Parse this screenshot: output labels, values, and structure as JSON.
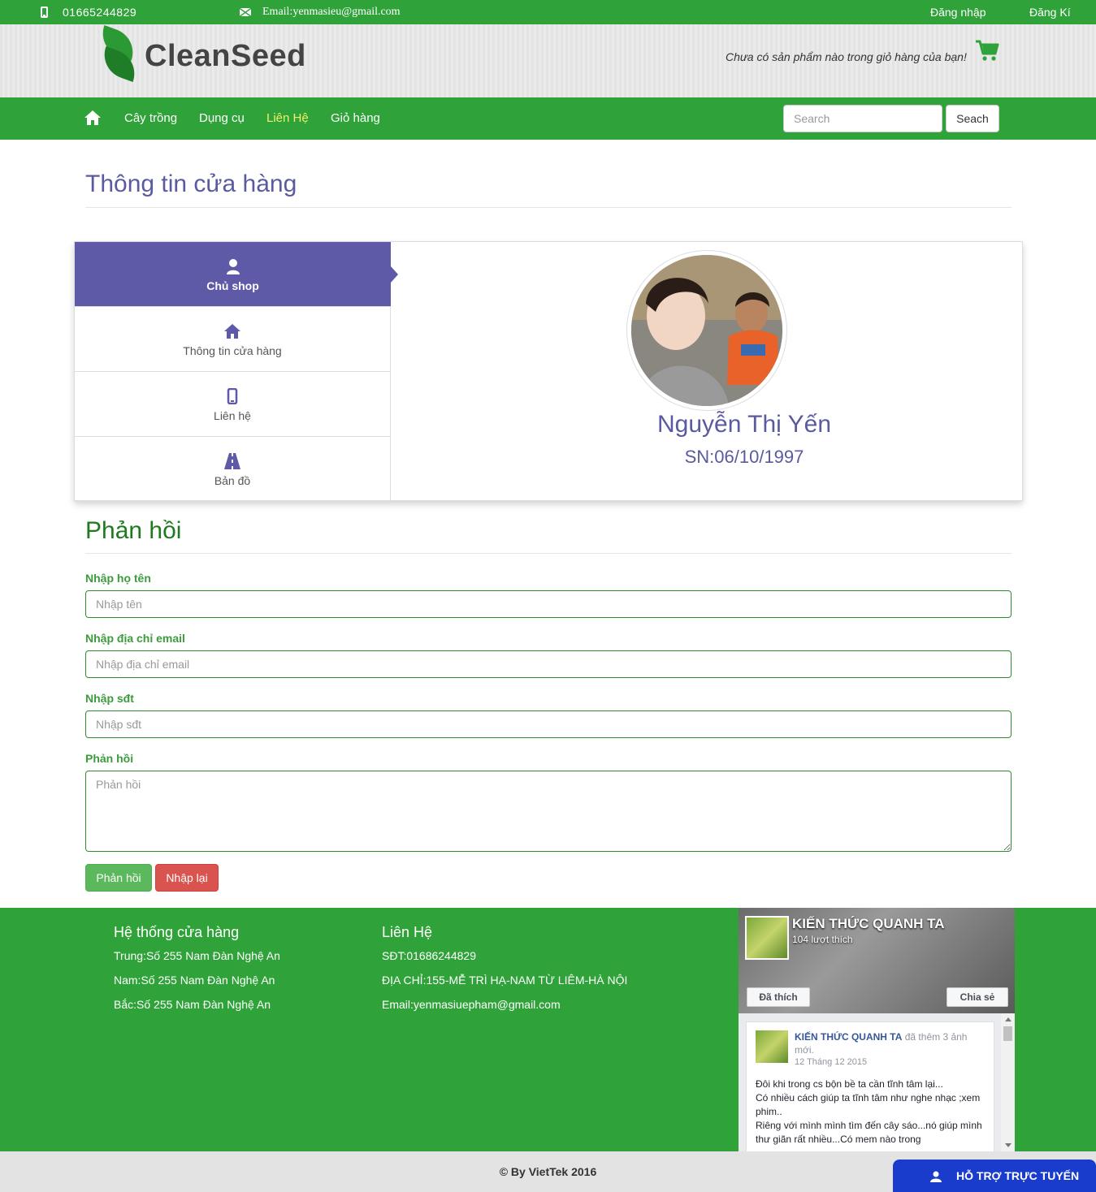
{
  "topbar": {
    "phone": "01665244829",
    "email": "Email:yenmasieu@gmail.com",
    "login": "Đăng nhập",
    "register": "Đăng Kí"
  },
  "header": {
    "logo_text": "CleanSeed",
    "cart_message": "Chưa có sản phẩm nào trong giỏ hàng của bạn!"
  },
  "nav": {
    "items": [
      "Cây trồng",
      "Dụng cụ",
      "Liên Hệ",
      "Giỏ hàng"
    ],
    "active": "Liên Hệ",
    "search_placeholder": "Search",
    "search_button": "Seach"
  },
  "store": {
    "title": "Thông tin cửa hàng",
    "tabs": [
      {
        "label": "Chủ shop",
        "icon": "user-icon"
      },
      {
        "label": "Thông tin cửa hàng",
        "icon": "home-icon"
      },
      {
        "label": "Liên hệ",
        "icon": "mobile-icon"
      },
      {
        "label": "Bản đồ",
        "icon": "road-icon"
      }
    ],
    "owner_name": "Nguyễn Thị Yến",
    "owner_dob": "SN:06/10/1997"
  },
  "feedback": {
    "title": "Phản hồi",
    "name_label": "Nhập họ tên",
    "name_placeholder": "Nhập tên",
    "email_label": "Nhập địa chỉ email",
    "email_placeholder": "Nhập địa chỉ email",
    "phone_label": "Nhập sđt",
    "phone_placeholder": "Nhập sđt",
    "message_label": "Phản hồi",
    "message_placeholder": "Phản hồi",
    "submit": "Phản hồi",
    "reset": "Nhập lại"
  },
  "footer": {
    "stores_title": "Hệ thống cửa hàng",
    "stores": [
      "Trung:Số 255 Nam Đàn Nghệ An",
      "Nam:Số 255 Nam Đàn Nghệ An",
      "Bắc:Số 255 Nam Đàn Nghệ An"
    ],
    "contact_title": "Liên Hệ",
    "contact": [
      "SĐT:01686244829",
      "ĐỊA CHỈ:155-MỄ TRÌ HẠ-NAM TỪ LIÊM-HÀ NỘI",
      "Email:yenmasiuepham@gmail.com"
    ],
    "fb": {
      "page_name": "KIẾN THỨC QUANH TA",
      "likes": "104 lượt thích",
      "liked_button": "Đã thích",
      "share_button": "Chia sẻ",
      "post_author": "KIẾN THỨC QUANH TA",
      "post_action": "đã thêm 3 ảnh mới.",
      "post_date": "12 Tháng 12 2015",
      "post_lines": [
        "Đôi khi trong cs bộn bề ta cần tĩnh tâm lại...",
        "Có nhiều cách giúp ta tĩnh tâm như nghe nhạc ;xem phim..",
        "Riêng với mình mình tìm đến cây sáo...nó giúp mình thư giãn rất nhiều...Có mem nào trong"
      ]
    },
    "copyright": "© By VietTek 2016",
    "support": "HỖ TRỢ TRỰC TUYẾN"
  },
  "colors": {
    "brand_green": "#2fa33a",
    "accent_purple": "#5e5aa8",
    "nav_active": "#f0f06a",
    "support_blue": "#1a3ccc"
  }
}
